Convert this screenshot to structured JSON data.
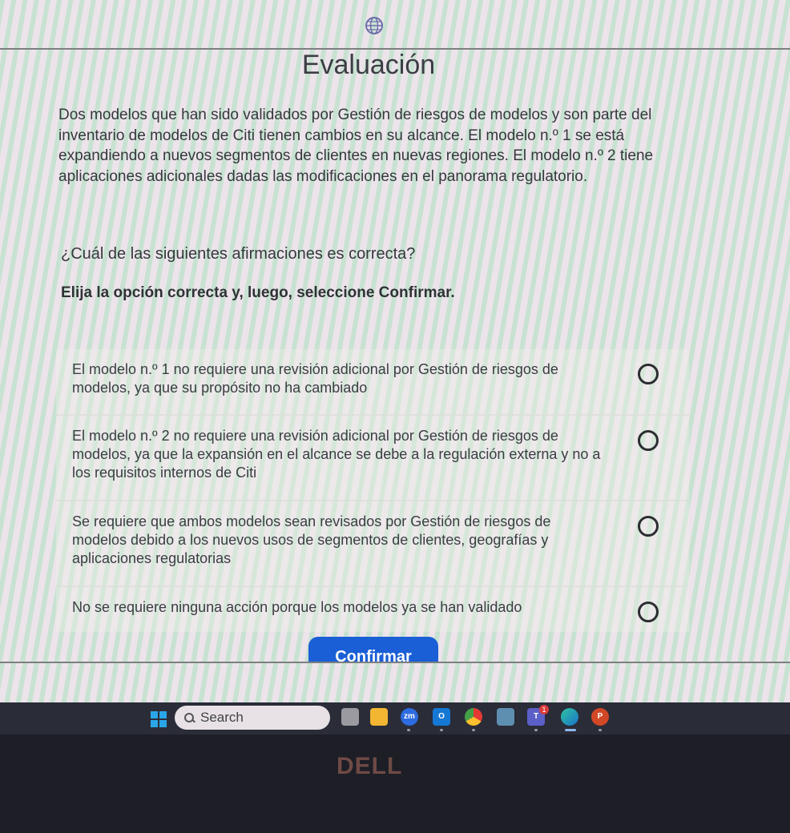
{
  "page": {
    "title": "Evaluación",
    "intro": "Dos modelos que han sido validados por Gestión de riesgos de modelos y son parte del inventario de modelos de Citi tienen cambios en su alcance. El modelo n.º 1 se está expandiendo a nuevos segmentos de clientes en nuevas regiones. El modelo n.º 2 tiene aplicaciones adicionales dadas las modificaciones en el panorama regulatorio.",
    "question": "¿Cuál de las siguientes afirmaciones es correcta?",
    "instruction": "Elija la opción correcta y, luego, seleccione Confirmar.",
    "options": [
      {
        "label": "El modelo n.º 1 no requiere una revisión adicional por Gestión de riesgos de modelos, ya que su propósito no ha cambiado",
        "selected": false
      },
      {
        "label": "El modelo n.º 2 no requiere una revisión adicional por Gestión de riesgos de modelos, ya que la expansión en el alcance se debe a la regulación externa y no a los requisitos internos de Citi",
        "selected": false
      },
      {
        "label": "Se requiere que ambos modelos sean revisados por Gestión de riesgos de modelos debido a los nuevos usos de segmentos de clientes, geografías y aplicaciones regulatorias",
        "selected": false
      },
      {
        "label": "No se requiere ninguna acción porque los modelos ya se han validado",
        "selected": false
      }
    ],
    "confirm_label": "Confirmar",
    "header_icon": "globe-icon"
  },
  "taskbar": {
    "search_placeholder": "Search",
    "apps": [
      {
        "name": "task-view",
        "icon": "task-view-icon"
      },
      {
        "name": "file-explorer",
        "icon": "folder-icon"
      },
      {
        "name": "zoom",
        "icon": "zoom-icon",
        "text": "zm"
      },
      {
        "name": "outlook",
        "icon": "outlook-icon",
        "text": "O"
      },
      {
        "name": "chrome",
        "icon": "chrome-icon"
      },
      {
        "name": "calculator",
        "icon": "calculator-icon"
      },
      {
        "name": "teams",
        "icon": "teams-icon",
        "text": "T",
        "badge": "1"
      },
      {
        "name": "edge",
        "icon": "edge-icon"
      },
      {
        "name": "powerpoint",
        "icon": "powerpoint-icon",
        "text": "P"
      }
    ]
  },
  "bezel": {
    "brand": "DELL"
  },
  "colors": {
    "confirm_button": "#1a5fd6",
    "taskbar": "#2a2c38",
    "windows_logo": "#2aa6e8"
  }
}
